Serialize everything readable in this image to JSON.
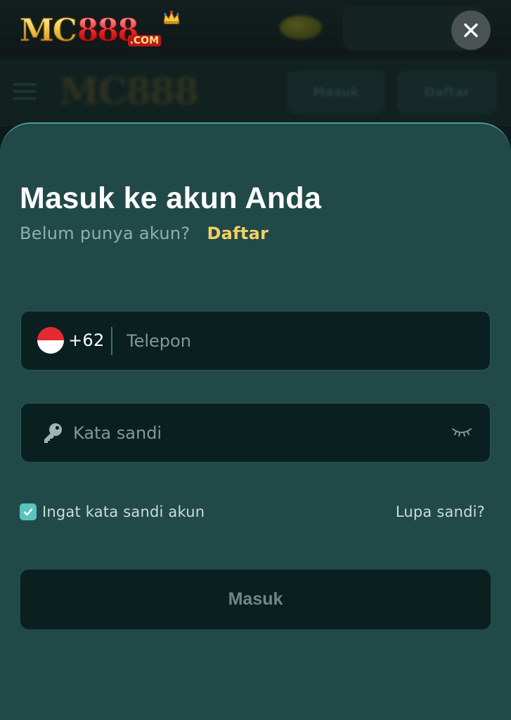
{
  "backdrop": {
    "nav_login_label": "Masuk",
    "nav_register_label": "Daftar"
  },
  "brand": {
    "logo_main": "MC",
    "logo_number": "888",
    "logo_suffix": ".COM"
  },
  "close_icon": "close-icon",
  "login": {
    "title": "Masuk ke akun Anda",
    "no_account_text": "Belum punya akun?",
    "register_link": "Daftar",
    "phone": {
      "country_flag": "indonesia-flag-icon",
      "dial_code": "+62",
      "placeholder": "Telepon",
      "value": ""
    },
    "password": {
      "icon": "key-icon",
      "placeholder": "Kata sandi",
      "value": "",
      "toggle_icon": "eye-closed-icon"
    },
    "remember": {
      "label": "Ingat kata sandi akun",
      "checked": true
    },
    "forgot_link": "Lupa sandi?",
    "submit_label": "Masuk"
  },
  "colors": {
    "sheet_bg": "#204948",
    "field_bg": "#0a1f20",
    "accent_link": "#f3cf63",
    "checkbox": "#5ac3bd"
  }
}
